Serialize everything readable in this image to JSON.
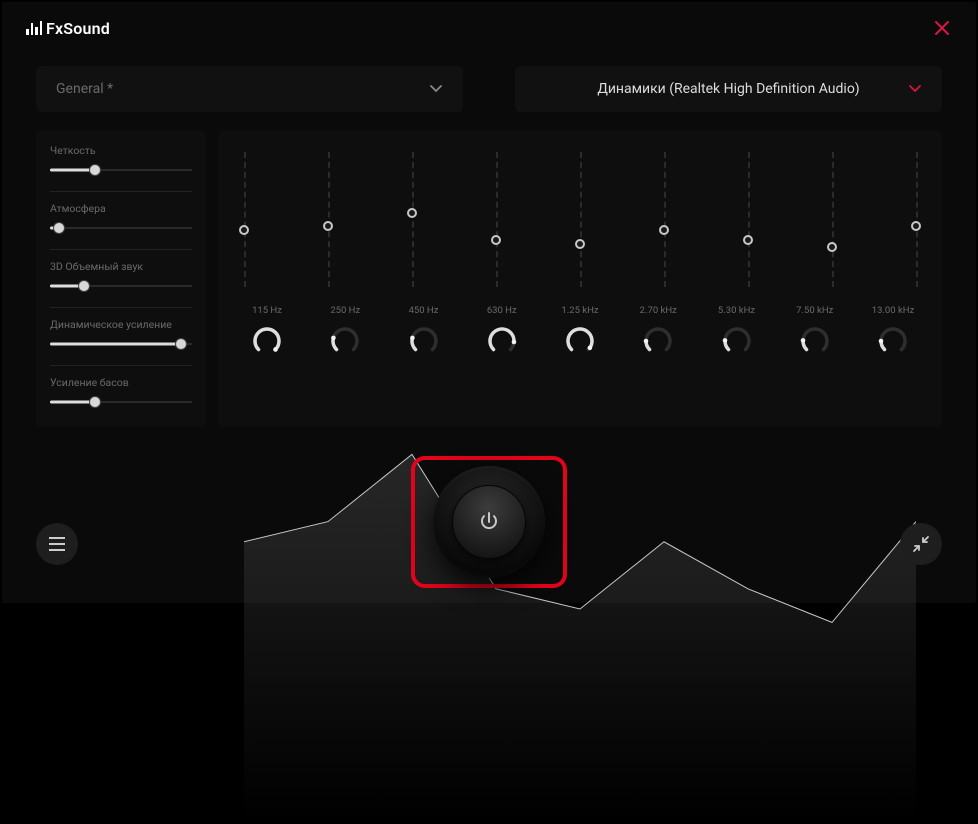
{
  "app": {
    "name": "FxSound"
  },
  "preset": {
    "label": "General *"
  },
  "device": {
    "label": "Динамики (Realtek High Definition Audio)"
  },
  "sliders": [
    {
      "label": "Четкость",
      "value": 32
    },
    {
      "label": "Атмосфера",
      "value": 6
    },
    {
      "label": "3D Объемный звук",
      "value": 24
    },
    {
      "label": "Динамическое усиление",
      "value": 92
    },
    {
      "label": "Усиление басов",
      "value": 32
    }
  ],
  "eq": {
    "bands": [
      {
        "freq": "115 Hz",
        "y": 58,
        "knob": 275
      },
      {
        "freq": "250 Hz",
        "y": 55,
        "knob": 60
      },
      {
        "freq": "450 Hz",
        "y": 45,
        "knob": 60
      },
      {
        "freq": "630 Hz",
        "y": 65,
        "knob": 230
      },
      {
        "freq": "1.25 kHz",
        "y": 68,
        "knob": 260
      },
      {
        "freq": "2.70 kHz",
        "y": 58,
        "knob": 45
      },
      {
        "freq": "5.30 kHz",
        "y": 65,
        "knob": 48
      },
      {
        "freq": "7.50 kHz",
        "y": 70,
        "knob": 48
      },
      {
        "freq": "13.00 kHz",
        "y": 55,
        "knob": 45
      }
    ]
  },
  "colors": {
    "accent": "#d8163e",
    "highlight": "#e2041b"
  }
}
